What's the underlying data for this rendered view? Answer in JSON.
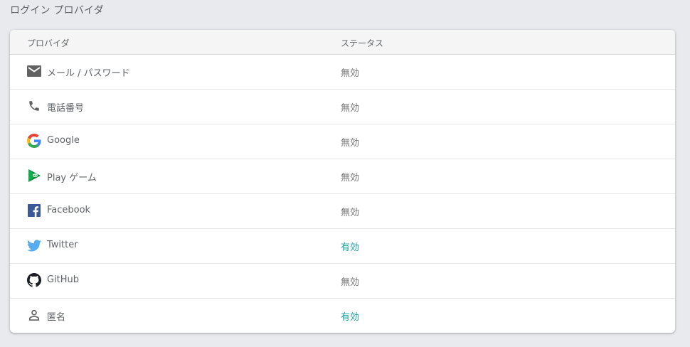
{
  "section": {
    "title": "ログイン プロバイダ"
  },
  "table": {
    "headers": {
      "provider": "プロバイダ",
      "status": "ステータス"
    },
    "rows": [
      {
        "icon": "mail-icon",
        "name": "メール / パスワード",
        "status": "無効",
        "enabled": false
      },
      {
        "icon": "phone-icon",
        "name": "電話番号",
        "status": "無効",
        "enabled": false
      },
      {
        "icon": "google-icon",
        "name": "Google",
        "status": "無効",
        "enabled": false
      },
      {
        "icon": "play-games-icon",
        "name": "Play ゲーム",
        "status": "無効",
        "enabled": false
      },
      {
        "icon": "facebook-icon",
        "name": "Facebook",
        "status": "無効",
        "enabled": false
      },
      {
        "icon": "twitter-icon",
        "name": "Twitter",
        "status": "有効",
        "enabled": true
      },
      {
        "icon": "github-icon",
        "name": "GitHub",
        "status": "無効",
        "enabled": false
      },
      {
        "icon": "person-icon",
        "name": "匿名",
        "status": "有効",
        "enabled": true
      }
    ]
  },
  "colors": {
    "enabled": "#1aa0a0",
    "disabled": "#757575",
    "facebook": "#3b5998",
    "twitter": "#55acee"
  }
}
